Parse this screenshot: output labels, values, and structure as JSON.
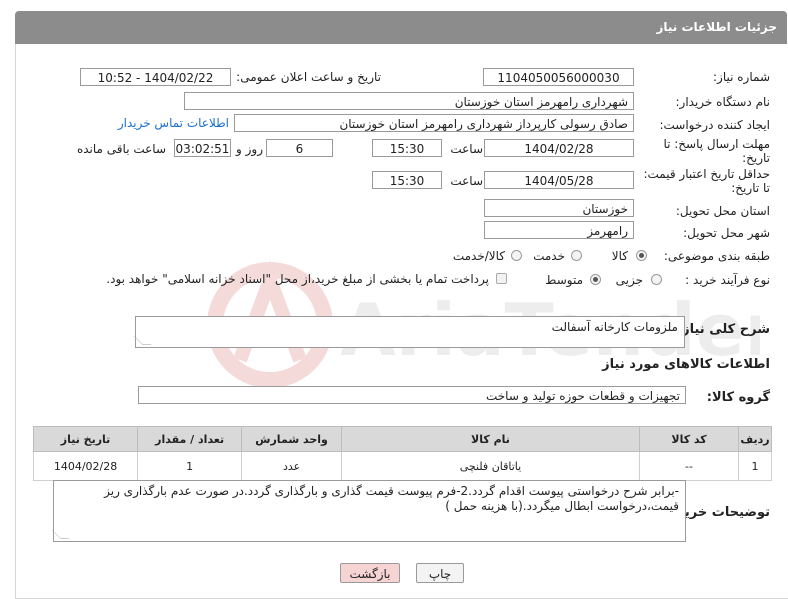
{
  "header": {
    "title": "جزئیات اطلاعات نیاز"
  },
  "form": {
    "need_number_label": "شماره نیاز:",
    "need_number": "1104050056000030",
    "announce_label": "تاریخ و ساعت اعلان عمومی:",
    "announce_value": "1404/02/22 - 10:52",
    "buyer_org_label": "نام دستگاه خریدار:",
    "buyer_org": "شهرداری رامهرمز استان خوزستان",
    "creator_label": "ایجاد کننده درخواست:",
    "creator": "صادق رسولی کارپرداز شهرداری رامهرمز استان خوزستان",
    "contact_link": "اطلاعات تماس خریدار",
    "deadline_label_1": "مهلت ارسال پاسخ: تا",
    "deadline_label_2": "تاریخ:",
    "deadline_date": "1404/02/28",
    "time_label": "ساعت",
    "deadline_time": "15:30",
    "days_value": "6",
    "days_label": "روز و",
    "remaining_value": "03:02:51",
    "remaining_label": "ساعت باقی مانده",
    "validity_label_1": "حداقل تاریخ اعتبار قیمت:",
    "validity_label_2": "تا تاریخ:",
    "validity_date": "1404/05/28",
    "validity_time": "15:30",
    "province_label": "استان محل تحویل:",
    "province": "خوزستان",
    "city_label": "شهر محل تحویل:",
    "city": "رامهرمز",
    "category_label": "طبقه بندی موضوعی:",
    "category_options": [
      "کالا",
      "خدمت",
      "کالا/خدمت"
    ],
    "process_label": "نوع فرآیند خرید :",
    "process_options": [
      "جزیی",
      "متوسط"
    ],
    "payment_note": "پرداخت تمام یا بخشی از مبلغ خرید،از محل \"اسناد خزانه اسلامی\" خواهد بود.",
    "summary_label": "شرح کلی نیاز:",
    "summary": "ملزومات کارخانه آسفالت",
    "goods_info_title": "اطلاعات کالاهای مورد نیاز",
    "goods_group_label": "گروه کالا:",
    "goods_group": "تجهیزات و قطعات حوزه تولید و ساخت",
    "buyer_notes_label": "توضیحات خریدار:",
    "buyer_notes": "-برابر شرح درخواستی پیوست اقدام گردد.2-فرم پیوست قیمت گذاری و بارگذاری گردد.در صورت عدم بارگذاری ریز قیمت،درخواست ابطال میگردد.(با هزینه حمل )"
  },
  "table": {
    "headers": [
      "ردیف",
      "کد کالا",
      "نام کالا",
      "واحد شمارش",
      "تعداد / مقدار",
      "تاریخ نیاز"
    ],
    "rows": [
      [
        "1",
        "--",
        "یاتاقان فلنچی",
        "عدد",
        "1",
        "1404/02/28"
      ]
    ]
  },
  "buttons": {
    "print": "چاپ",
    "back": "بازگشت"
  },
  "watermark": {
    "text": "AriaTender.neT"
  },
  "colors": {
    "header_bg": "#8c8c8c",
    "link": "#1b6fc9",
    "back_button_bg": "#f7d4d4"
  }
}
